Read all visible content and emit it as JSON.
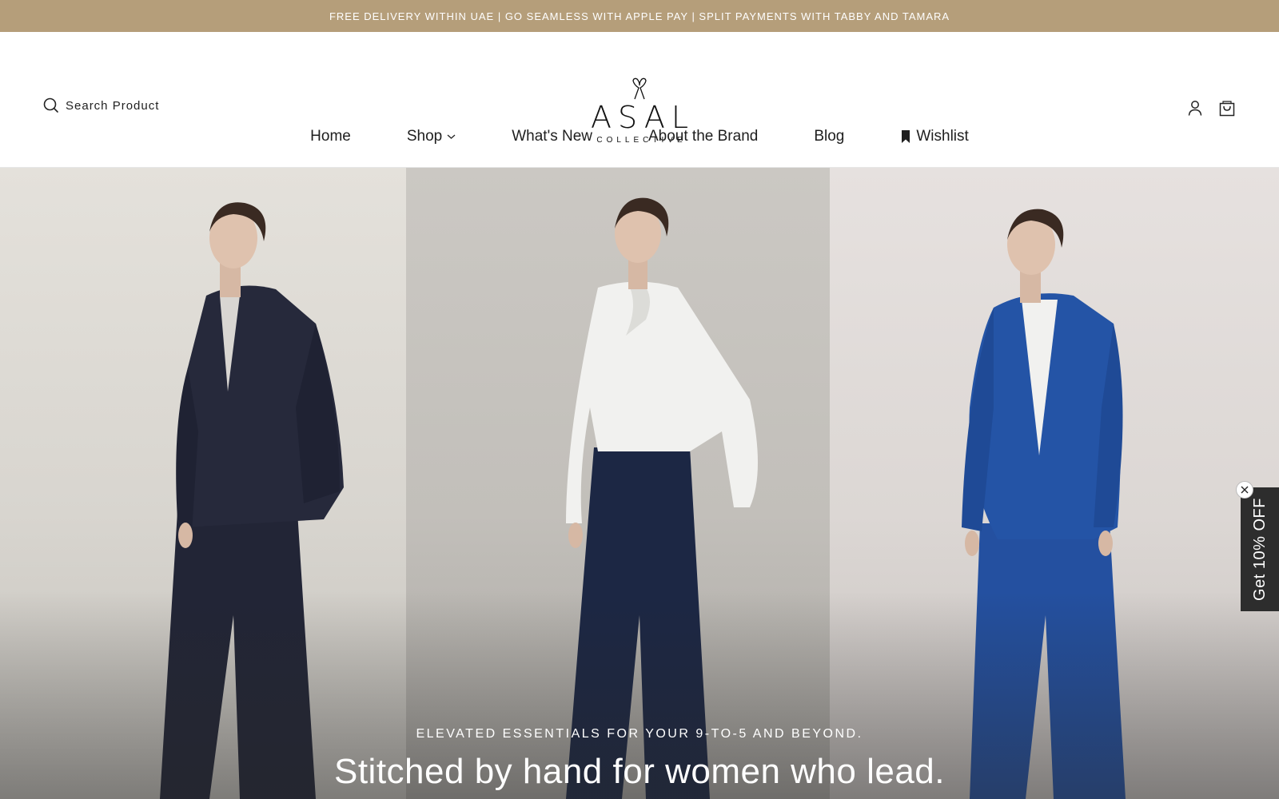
{
  "announcement": {
    "text": "FREE DELIVERY WITHIN UAE | GO SEAMLESS WITH APPLE PAY | SPLIT PAYMENTS WITH TABBY AND TAMARA"
  },
  "header": {
    "search_label": "Search Product",
    "logo": {
      "name": "ASAL",
      "sub": "COLLECTIVE"
    },
    "icons": [
      "account-icon",
      "cart-icon"
    ]
  },
  "nav": {
    "items": [
      {
        "label": "Home"
      },
      {
        "label": "Shop"
      },
      {
        "label": "What's New"
      },
      {
        "label": "About the Brand"
      },
      {
        "label": "Blog"
      },
      {
        "label": "Wishlist"
      }
    ]
  },
  "hero": {
    "eyebrow": "ELEVATED ESSENTIALS FOR YOUR 9-TO-5 AND BEYOND.",
    "title": "Stitched by hand for women who lead."
  },
  "discount": {
    "label": "Get 10% OFF"
  },
  "colors": {
    "announcement_bg": "#b59e7a",
    "discount_bg": "#2d2d2d",
    "navy_suit": "#24273a",
    "blue_suit": "#2454a6",
    "trousers": "#1c2744"
  }
}
